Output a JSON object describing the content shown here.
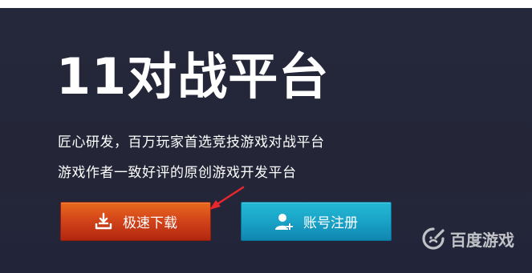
{
  "hero": {
    "title": "11对战平台",
    "tagline_1": "匠心研发，百万玩家首选竞技游戏对战平台",
    "tagline_2": "游戏作者一致好评的原创游戏开发平台"
  },
  "buttons": {
    "download_label": "极速下载",
    "download_icon": "download-tray-icon",
    "register_label": "账号注册",
    "register_icon": "add-user-icon"
  },
  "watermark": {
    "text": "百度游戏",
    "icon": "baidu-game-logo-icon"
  },
  "colors": {
    "background": "#25283a",
    "download_button": "#d3461a",
    "register_button": "#1aa3c7",
    "arrow": "#e8262e"
  }
}
